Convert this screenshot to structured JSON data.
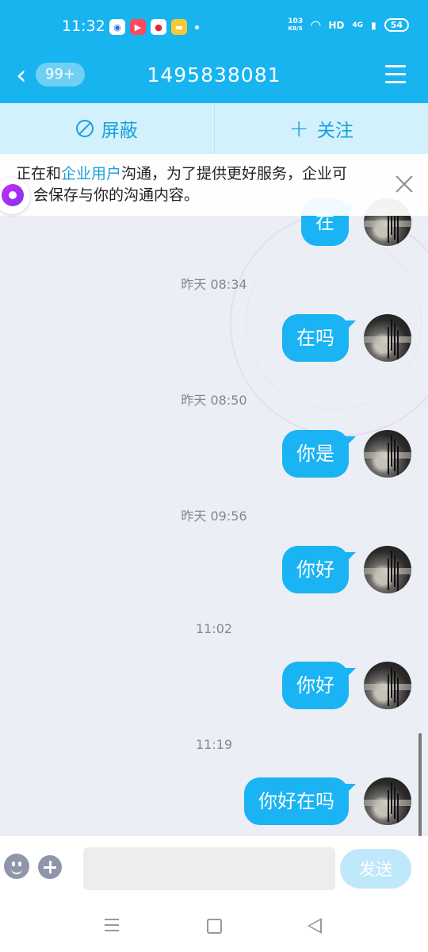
{
  "status_bar": {
    "time": "11:32",
    "net_speed_value": "103",
    "net_speed_unit": "KB/S",
    "hd_label": "HD",
    "signal_label": "4G",
    "battery": "54"
  },
  "header": {
    "back_badge": "99+",
    "title": "1495838081"
  },
  "actions": {
    "block_label": "屏蔽",
    "follow_label": "关注"
  },
  "notice": {
    "prefix": "正在和",
    "highlight": "企业用户",
    "line1_rest": "沟通，为了提供更好服务，企业可",
    "line2": "会保存与你的沟通内容。"
  },
  "messages": [
    {
      "timestamp": "",
      "text": "在"
    },
    {
      "timestamp": "昨天 08:34",
      "text": "在吗"
    },
    {
      "timestamp": "昨天 08:50",
      "text": "你是"
    },
    {
      "timestamp": "昨天 09:56",
      "text": "你好"
    },
    {
      "timestamp": "11:02",
      "text": "你好"
    },
    {
      "timestamp": "11:19",
      "text": "你好在吗"
    }
  ],
  "input": {
    "placeholder": "",
    "send_label": "发送"
  },
  "colors": {
    "primary": "#18b4f0",
    "bubble": "#1ab3f3",
    "action_bar": "#d3f1fc",
    "chat_bg": "#eceef5"
  }
}
